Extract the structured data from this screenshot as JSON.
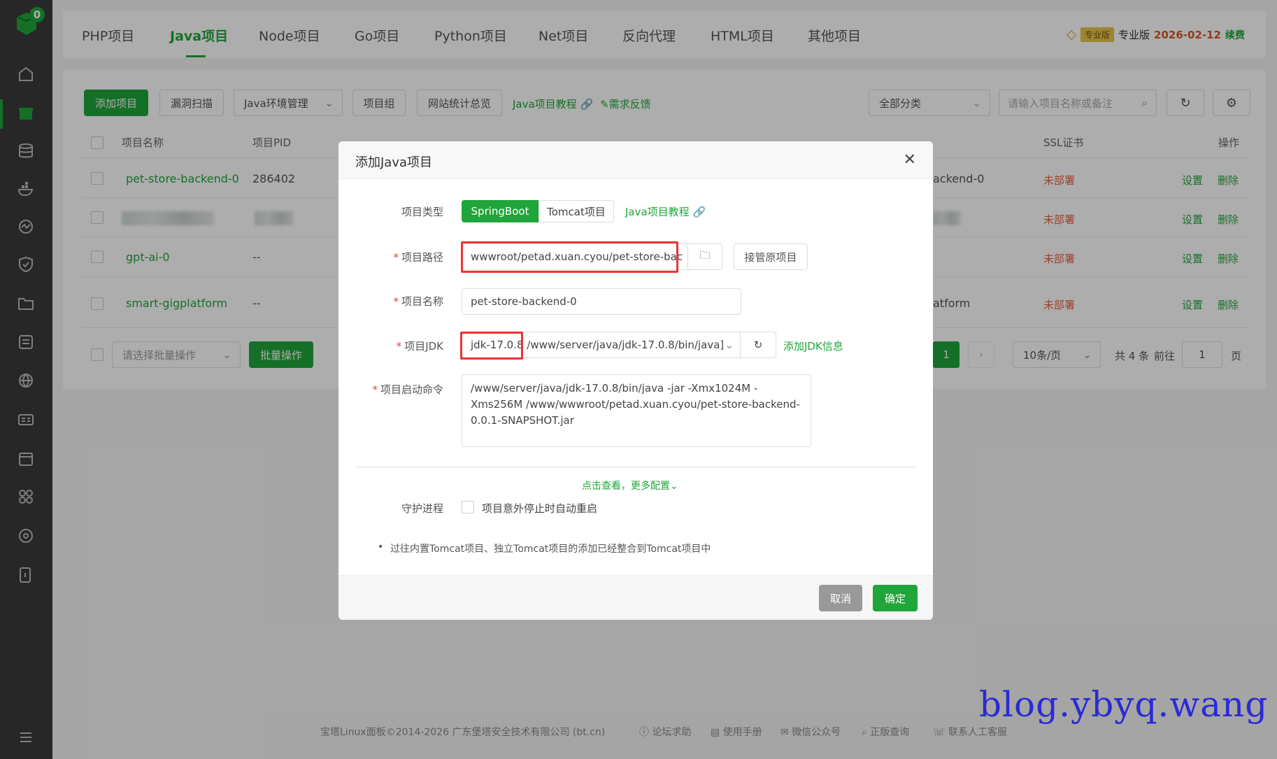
{
  "sidebar": {
    "badge_count": "0",
    "icons": [
      "home-icon",
      "box-icon",
      "database-icon",
      "docker-icon",
      "monitor-icon",
      "shield-icon",
      "folder-icon",
      "log-icon",
      "globe-icon",
      "id-card-icon",
      "calendar-icon",
      "apps-icon",
      "settings-icon",
      "exit-icon",
      "menu-icon"
    ]
  },
  "tabs": [
    "PHP项目",
    "Java项目",
    "Node项目",
    "Go项目",
    "Python项目",
    "Net项目",
    "反向代理",
    "HTML项目",
    "其他项目"
  ],
  "pro": {
    "tag": "专业版",
    "label": "专业版",
    "date": "2026-02-12",
    "renew": "续费"
  },
  "toolbar": {
    "add": "添加项目",
    "scan": "漏洞扫描",
    "env": "Java环境管理",
    "group": "项目组",
    "stats": "网站统计总览",
    "tutorial": "Java项目教程",
    "feedback": "需求反馈",
    "category": "全部分类",
    "search_placeholder": "请输入项目名称或备注"
  },
  "table": {
    "headers": {
      "name": "项目名称",
      "pid": "项目PID",
      "ssl": "SSL证书",
      "ops": "操作"
    },
    "rows": [
      {
        "name": "pet-store-backend-0",
        "pid": "286402",
        "right": "ackend-0",
        "ssl": "未部署",
        "set": "设置",
        "del": "删除"
      },
      {
        "name": "",
        "pid": "",
        "right": "",
        "ssl": "未部署",
        "set": "设置",
        "del": "删除"
      },
      {
        "name": "gpt-ai-0",
        "pid": "--",
        "right": "",
        "ssl": "未部署",
        "set": "设置",
        "del": "删除"
      },
      {
        "name": "smart-gigplatform",
        "pid": "--",
        "right": "atform",
        "ssl": "未部署",
        "set": "设置",
        "del": "删除"
      }
    ],
    "batch_placeholder": "请选择批量操作",
    "batch_btn": "批量操作",
    "page": "1",
    "per_page": "10条/页",
    "total": "共 4 条",
    "goto": "前往",
    "goto_page": "1",
    "page_unit": "页"
  },
  "modal": {
    "title": "添加Java项目",
    "type_label": "项目类型",
    "type_springboot": "SpringBoot",
    "type_tomcat": "Tomcat项目",
    "type_tutorial": "Java项目教程",
    "path_label": "项目路径",
    "path_value": "wwwroot/petad.xuan.cyou/pet-store-bac",
    "takeover": "接管原项目",
    "name_label": "项目名称",
    "name_value": "pet-store-backend-0",
    "jdk_label": "项目JDK",
    "jdk_value": "jdk-17.0.8 /www/server/java/jdk-17.0.8/bin/java]",
    "jdk_add": "添加JDK信息",
    "cmd_label": "项目启动命令",
    "cmd_value": "/www/server/java/jdk-17.0.8/bin/java -jar  -Xmx1024M -Xms256M /www/wwwroot/petad.xuan.cyou/pet-store-backend-0.0.1-SNAPSHOT.jar",
    "more": "点击查看，更多配置",
    "daemon_label": "守护进程",
    "daemon_text": "项目意外停止时自动重启",
    "note": "过往内置Tomcat项目、独立Tomcat项目的添加已经整合到Tomcat项目中",
    "cancel": "取消",
    "confirm": "确定"
  },
  "footer": {
    "copyright": "宝塔Linux面板©2014-2026 广东堡塔安全技术有限公司 (bt.cn)",
    "forum": "论坛求助",
    "manual": "使用手册",
    "wechat": "微信公众号",
    "genuine": "正版查询",
    "support": "联系人工客服"
  },
  "watermark": "blog.ybyq.wang",
  "colors": {
    "brand": "#20a53a",
    "warning": "#e8613c",
    "highlight": "#e33333"
  }
}
